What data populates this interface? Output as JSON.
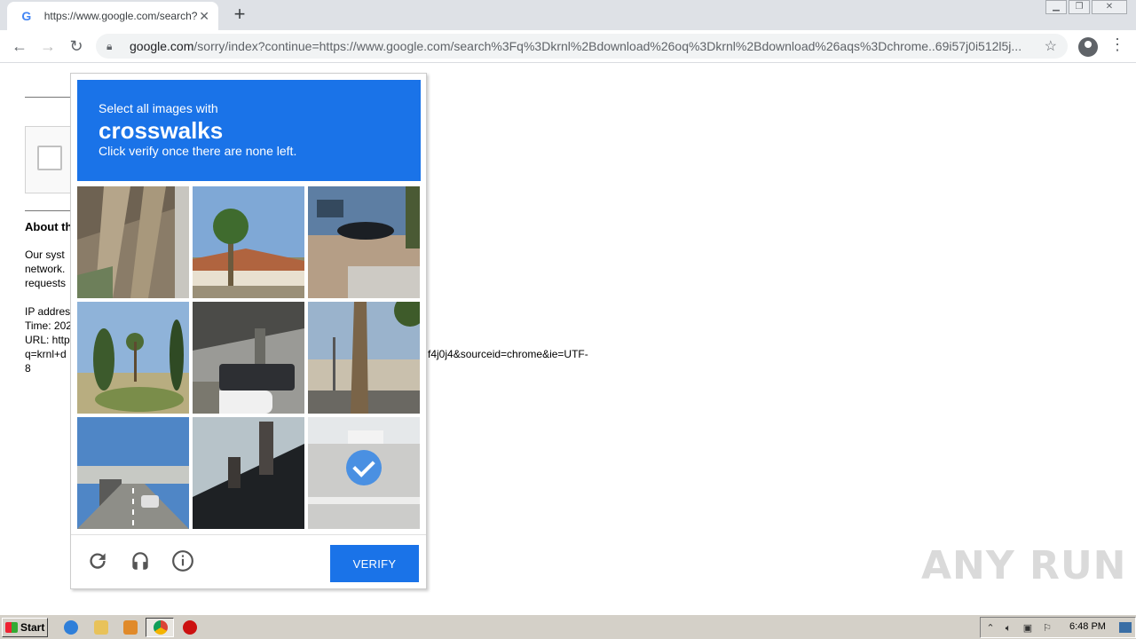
{
  "browser": {
    "tab_title": "https://www.google.com/search?q=",
    "tab_favicon": "G",
    "url_host": "google.com",
    "url_path": "/sorry/index?continue=https://www.google.com/search%3Fq%3Dkrnl%2Bdownload%26oq%3Dkrnl%2Bdownload%26aqs%3Dchrome..69i57j0i512l5j..."
  },
  "page": {
    "about_heading": "About th",
    "paragraph_lines": [
      "Our syst",
      "network.",
      "requests"
    ],
    "ip_line": "IP addres",
    "time_line": "Time: 202",
    "url_line": "URL: http",
    "url_line2": "q=krnl+d",
    "url_line3": "8",
    "url_tail": "f4j0j4&sourceid=chrome&ie=UTF-"
  },
  "captcha": {
    "instruction_pre": "Select all images with",
    "target": "crosswalks",
    "instruction_post": "Click verify once there are none left.",
    "verify_label": "VERIFY",
    "selected_tiles": [
      8
    ],
    "accent_color": "#1a73e8"
  },
  "watermark": "ANY RUN",
  "taskbar": {
    "start_label": "Start",
    "clock": "6:48 PM"
  }
}
